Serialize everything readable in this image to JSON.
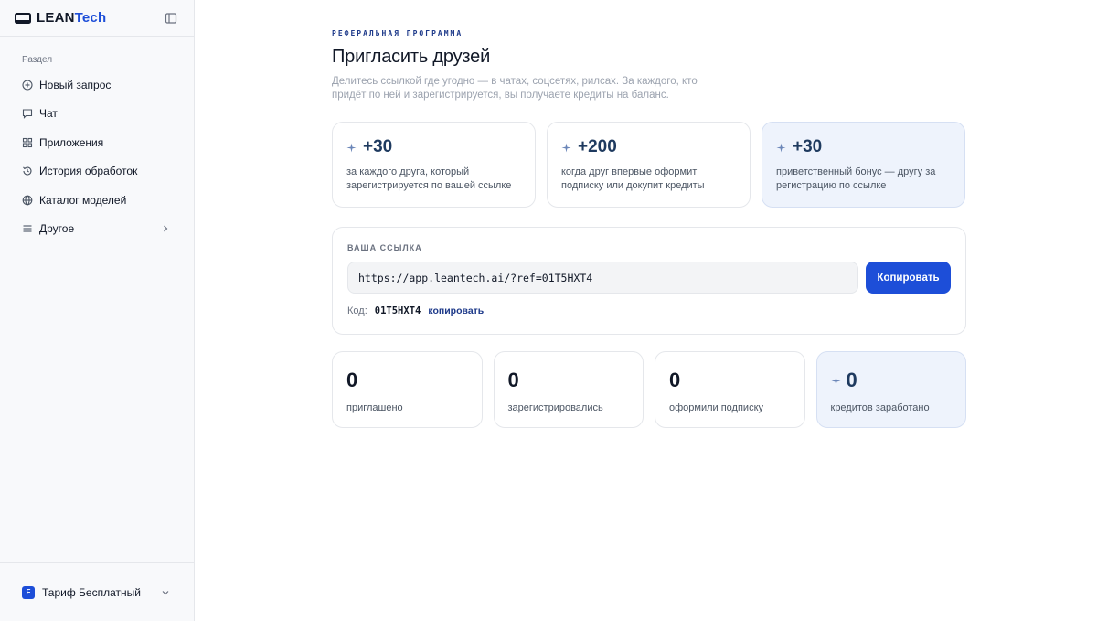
{
  "brand": {
    "name_part1": "LEAN",
    "name_part2": "Tech",
    "accent": "#1d4ed8"
  },
  "sidebar": {
    "section_label": "Раздел",
    "items": [
      {
        "label": "Новый запрос",
        "icon": "plus-circle-icon"
      },
      {
        "label": "Чат",
        "icon": "chat-icon"
      },
      {
        "label": "Приложения",
        "icon": "grid-icon"
      },
      {
        "label": "История обработок",
        "icon": "history-icon"
      },
      {
        "label": "Каталог моделей",
        "icon": "globe-icon"
      },
      {
        "label": "Другое",
        "icon": "menu-icon"
      }
    ],
    "plan": {
      "badge": "F",
      "label": "Тариф Бесплатный"
    }
  },
  "main": {
    "eyebrow": "РЕФЕРАЛЬНАЯ ПРОГРАММА",
    "title": "Пригласить друзей",
    "subtitle": "Делитесь ссылкой где угодно — в чатах, соцсетях, рилсах. За каждого, кто придёт по ней и зарегистрируется, вы получаете кредиты на баланс.",
    "rewards": [
      {
        "amount": "+30",
        "desc": "за каждого друга, который зарегистрируется по вашей ссылке"
      },
      {
        "amount": "+200",
        "desc": "когда друг впервые оформит подписку или докупит кредиты"
      },
      {
        "amount": "+30",
        "desc": "приветственный бонус — другу за регистрацию по ссылке"
      }
    ],
    "link": {
      "label": "ВАША ССЫЛКА",
      "url": "https://app.leantech.ai/?ref=01T5HXT4",
      "copy_button": "Копировать",
      "code_label": "Код:",
      "code_value": "01T5HXT4",
      "code_copy": "копировать"
    },
    "stats": [
      {
        "value": "0",
        "label": "приглашено"
      },
      {
        "value": "0",
        "label": "зарегистрировались"
      },
      {
        "value": "0",
        "label": "оформили подписку"
      },
      {
        "value": "0",
        "label": "кредитов заработано"
      }
    ]
  }
}
